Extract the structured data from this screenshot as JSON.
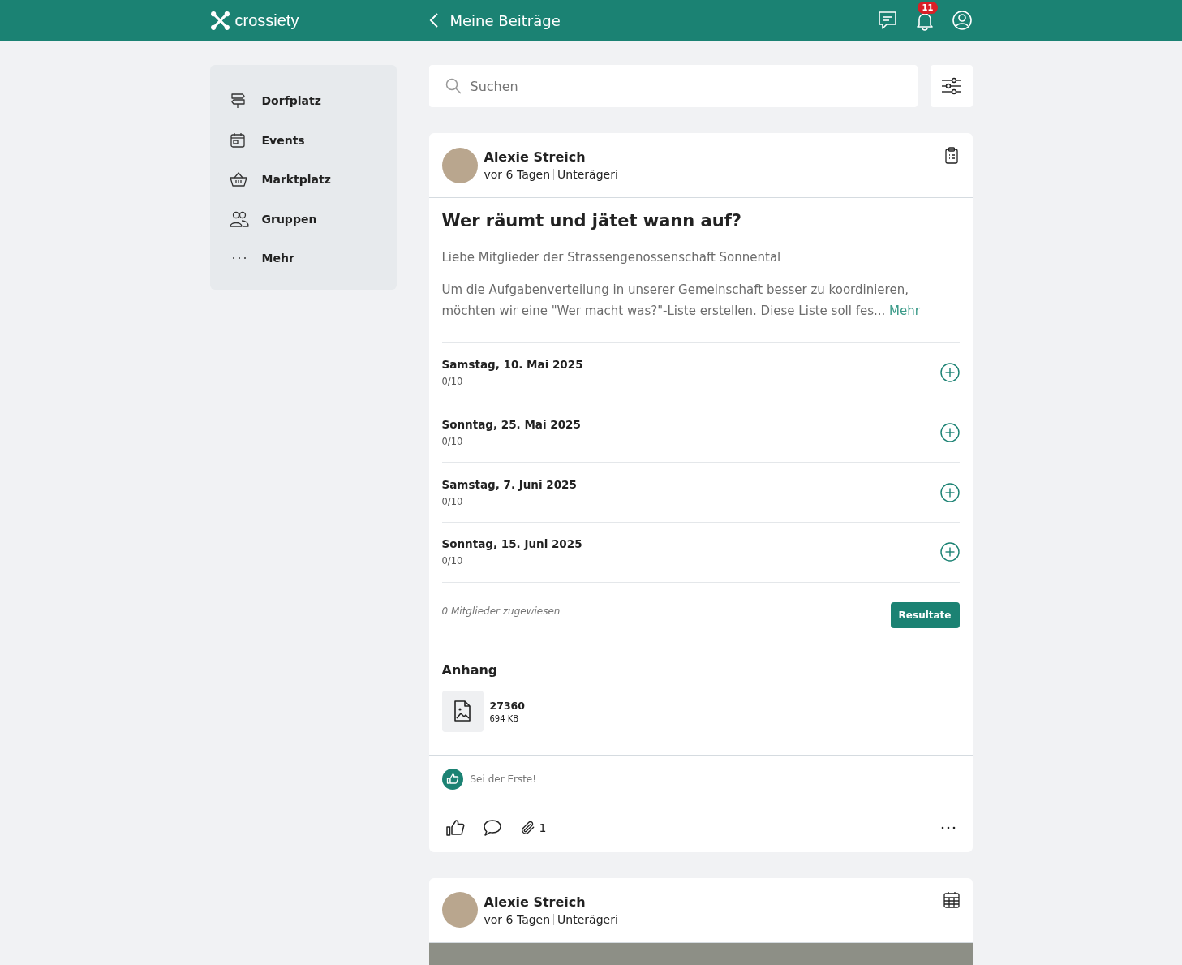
{
  "header": {
    "brand": "crossiety",
    "title": "Meine Beiträge",
    "notification_count": "11"
  },
  "sidebar": {
    "items": [
      {
        "label": "Dorfplatz"
      },
      {
        "label": "Events"
      },
      {
        "label": "Marktplatz"
      },
      {
        "label": "Gruppen"
      },
      {
        "label": "Mehr"
      }
    ]
  },
  "search": {
    "placeholder": "Suchen"
  },
  "posts": [
    {
      "kind": "survey",
      "author": "Alexie Streich",
      "time": "vor 6 Tagen",
      "place": "Unterägeri",
      "title": "Wer räumt und jätet wann auf?",
      "intro": "Liebe Mitglieder der Strassengenossenschaft Sonnental",
      "body": "Um die Aufgabenverteilung in unserer Gemeinschaft besser zu koordinieren, möchten wir eine \"Wer macht was?\"-Liste erstellen. Diese Liste soll fes...",
      "more": "Mehr",
      "slots": [
        {
          "date": "Samstag, 10. Mai 2025",
          "count": "0/10"
        },
        {
          "date": "Sonntag, 25. Mai 2025",
          "count": "0/10"
        },
        {
          "date": "Samstag, 7. Juni 2025",
          "count": "0/10"
        },
        {
          "date": "Sonntag, 15. Juni 2025",
          "count": "0/10"
        }
      ],
      "assigned": "0 Mitglieder zugewiesen",
      "results_button": "Resultate",
      "attachments_title": "Anhang",
      "attachments": [
        {
          "name": "27360",
          "size": "694 KB"
        }
      ],
      "likes_text": "Sei der Erste!",
      "attachment_count": "1"
    },
    {
      "kind": "event",
      "author": "Alexie Streich",
      "time": "vor 6 Tagen",
      "place": "Unterägeri"
    }
  ]
}
